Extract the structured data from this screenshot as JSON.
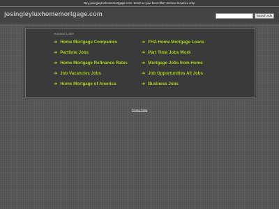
{
  "topbar": {
    "text": "Buy josingleyluxhomemortgage.com. Send us your best offer! Serious inquiries only."
  },
  "header": {
    "domain": "josingleyluxhomemortgage.com",
    "search_button": "Search Ads"
  },
  "panel": {
    "related_label": "Related Links",
    "arrow": "➔",
    "left_links": [
      "Home Mortgage Companies",
      "Parttime Jobs",
      "Home Mortgage Refinance Rates",
      "Job Vacancies Jobs",
      "Home Mortgage of America"
    ],
    "right_links": [
      "FHA Home Mortgage Loans",
      "Part Time Jobs Work",
      "Mortgage Jobs from Home",
      "Job Opportunities All Jobs",
      "Business Jobs"
    ]
  },
  "footer": {
    "privacy": "Privacy Policy"
  },
  "colors": {
    "link": "#a8cf1c",
    "panel_bg": "#3a3a3a",
    "page_bg": "#5b5b5b"
  }
}
